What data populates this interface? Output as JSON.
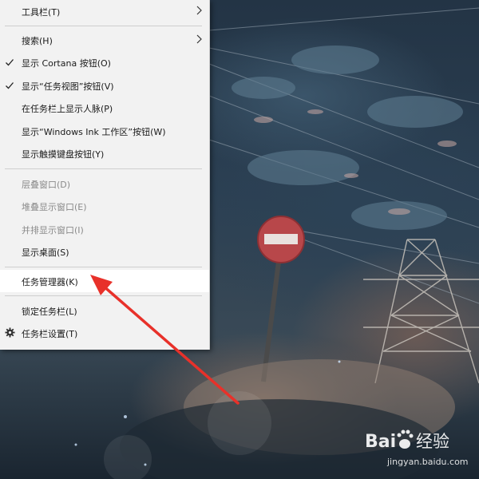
{
  "menu": {
    "items": [
      {
        "label": "工具栏(T)",
        "submenu": true,
        "checked": false,
        "enabled": true
      },
      {
        "label": "搜索(H)",
        "submenu": true,
        "checked": false,
        "enabled": true
      },
      {
        "label": "显示 Cortana 按钮(O)",
        "submenu": false,
        "checked": true,
        "enabled": true
      },
      {
        "label": "显示“任务视图”按钮(V)",
        "submenu": false,
        "checked": true,
        "enabled": true
      },
      {
        "label": "在任务栏上显示人脉(P)",
        "submenu": false,
        "checked": false,
        "enabled": true
      },
      {
        "label": "显示“Windows Ink 工作区”按钮(W)",
        "submenu": false,
        "checked": false,
        "enabled": true
      },
      {
        "label": "显示触摸键盘按钮(Y)",
        "submenu": false,
        "checked": false,
        "enabled": true
      },
      {
        "label": "层叠窗口(D)",
        "submenu": false,
        "checked": false,
        "enabled": false
      },
      {
        "label": "堆叠显示窗口(E)",
        "submenu": false,
        "checked": false,
        "enabled": false
      },
      {
        "label": "并排显示窗口(I)",
        "submenu": false,
        "checked": false,
        "enabled": false
      },
      {
        "label": "显示桌面(S)",
        "submenu": false,
        "checked": false,
        "enabled": true
      },
      {
        "label": "任务管理器(K)",
        "submenu": false,
        "checked": false,
        "enabled": true,
        "highlighted": true
      },
      {
        "label": "锁定任务栏(L)",
        "submenu": false,
        "checked": false,
        "enabled": true
      },
      {
        "label": "任务栏设置(T)",
        "submenu": false,
        "checked": false,
        "enabled": true,
        "icon": "gear-icon"
      }
    ]
  },
  "annotation": {
    "color": "#e8312a",
    "target": "任务管理器(K)"
  },
  "watermark": {
    "brand": "Bai度经验",
    "url": "jingyan.baidu.com"
  },
  "colors": {
    "menu_bg": "#f2f2f2",
    "highlight_bg": "#ffffff",
    "disabled_text": "#8a8a8a"
  }
}
